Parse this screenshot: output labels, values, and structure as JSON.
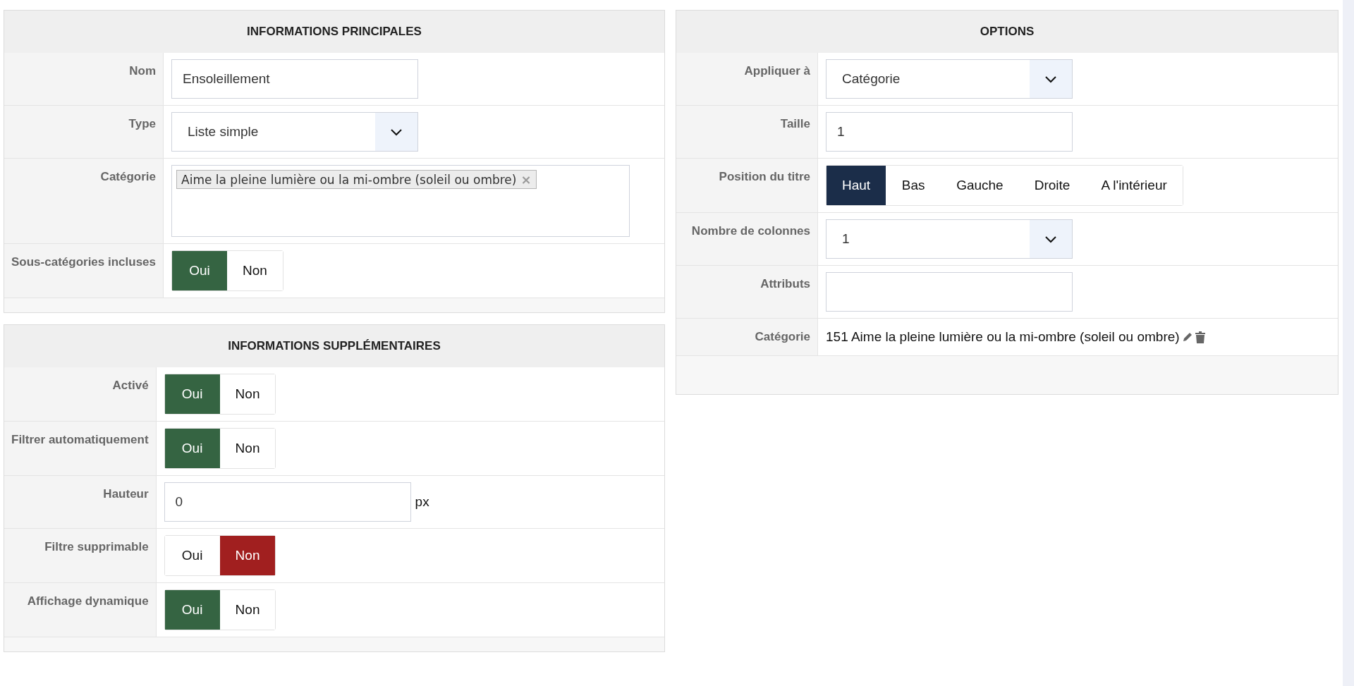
{
  "left_panels": [
    {
      "title": "INFORMATIONS PRINCIPALES",
      "rows": [
        {
          "kind": "text",
          "label": "Nom",
          "value": "Ensoleillement"
        },
        {
          "kind": "select",
          "label": "Type",
          "value": "Liste simple"
        },
        {
          "kind": "tags",
          "label": "Catégorie",
          "tags": [
            {
              "text": "Aime la pleine lumière ou la mi-ombre (soleil ou ombre)",
              "remove": "×"
            }
          ]
        },
        {
          "kind": "toggle",
          "label": "Sous-catégories incluses",
          "options": [
            {
              "label": "Oui",
              "selected": true
            },
            {
              "label": "Non",
              "selected": false
            }
          ]
        }
      ]
    },
    {
      "title": "INFORMATIONS SUPPLÉMENTAIRES",
      "rows": [
        {
          "kind": "toggle",
          "label": "Activé",
          "options": [
            {
              "label": "Oui",
              "selected": true
            },
            {
              "label": "Non",
              "selected": false
            }
          ]
        },
        {
          "kind": "toggle",
          "label": "Filtrer automatiquement",
          "options": [
            {
              "label": "Oui",
              "selected": true
            },
            {
              "label": "Non",
              "selected": false
            }
          ]
        },
        {
          "kind": "unit",
          "label": "Hauteur",
          "value": "0",
          "unit": "px"
        },
        {
          "kind": "toggle",
          "label": "Filtre supprimable",
          "options": [
            {
              "label": "Oui",
              "selected": false
            },
            {
              "label": "Non",
              "selected": true
            }
          ]
        },
        {
          "kind": "toggle",
          "label": "Affichage dynamique",
          "options": [
            {
              "label": "Oui",
              "selected": true
            },
            {
              "label": "Non",
              "selected": false
            }
          ]
        }
      ]
    }
  ],
  "right_panel": {
    "title": "OPTIONS",
    "rows": [
      {
        "kind": "select",
        "label": "Appliquer à",
        "value": "Catégorie"
      },
      {
        "kind": "text",
        "label": "Taille",
        "value": "1"
      },
      {
        "kind": "segmented",
        "label": "Position du titre",
        "options": [
          {
            "label": "Haut",
            "selected": true
          },
          {
            "label": "Bas",
            "selected": false
          },
          {
            "label": "Gauche",
            "selected": false
          },
          {
            "label": "Droite",
            "selected": false
          },
          {
            "label": "A l'intérieur",
            "selected": false
          }
        ]
      },
      {
        "kind": "select",
        "label": "Nombre de colonnes",
        "value": "1"
      },
      {
        "kind": "text",
        "label": "Attributs",
        "value": ""
      },
      {
        "kind": "static",
        "label": "Catégorie",
        "value": "151 Aime la pleine lumière ou la mi-ombre (soleil ou ombre)"
      }
    ]
  }
}
